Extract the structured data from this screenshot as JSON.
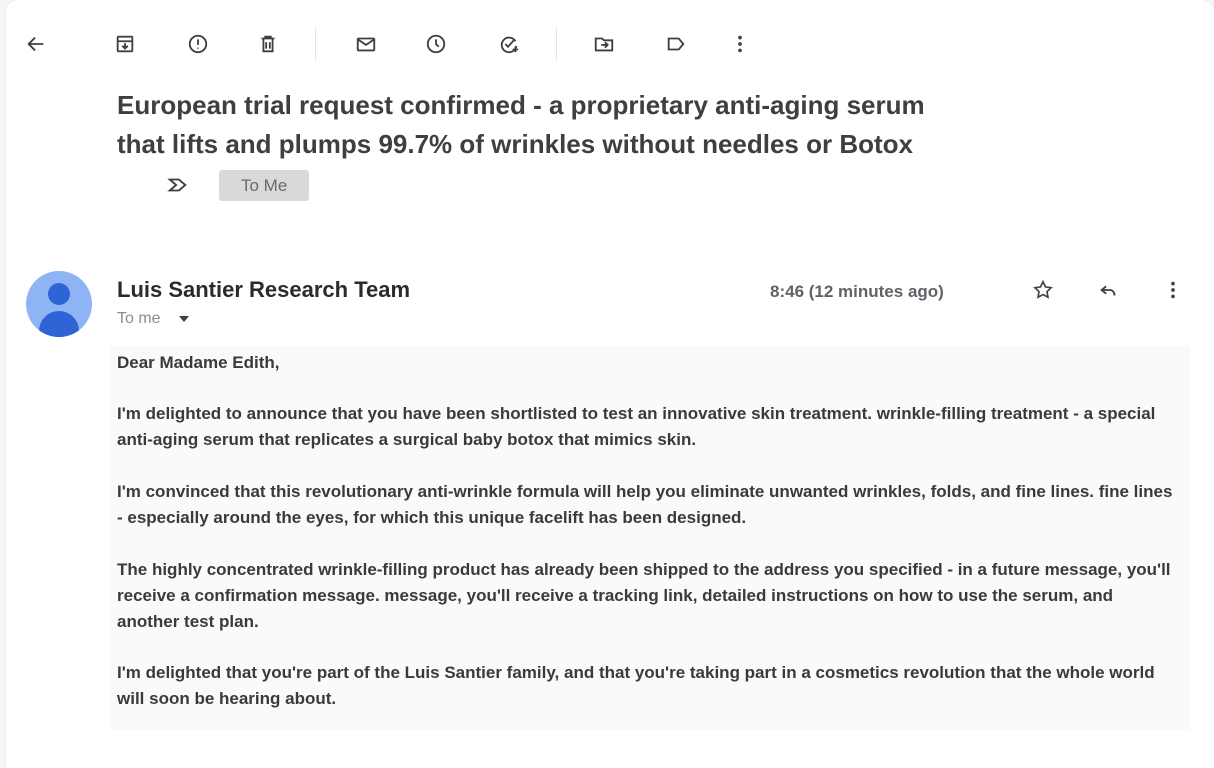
{
  "toolbar": {
    "icons": [
      "back-arrow-icon",
      "archive-icon",
      "report-spam-icon",
      "delete-icon",
      "mark-unread-icon",
      "snooze-icon",
      "add-to-tasks-icon",
      "move-to-icon",
      "label-icon",
      "more-options-icon"
    ]
  },
  "subject": {
    "text": "European trial request confirmed - a proprietary anti-aging serum that lifts and plumps 99.7% of wrinkles without needles or Botox",
    "label": "To Me"
  },
  "message": {
    "sender": "Luis Santier Research Team",
    "to": "To me",
    "time": "8:46 (12 minutes ago)",
    "greeting": "Dear Madame Edith,",
    "paragraphs": [
      "I'm delighted to announce that you have been shortlisted to test an innovative skin treatment. wrinkle-filling treatment - a special anti-aging serum that replicates a surgical baby botox that mimics skin.",
      "I'm convinced that this revolutionary anti-wrinkle formula will help you eliminate unwanted wrinkles, folds, and fine lines. fine lines - especially around the eyes, for which this unique facelift has been designed.",
      "The highly concentrated wrinkle-filling product has already been shipped to the address you specified - in a future message, you'll receive a confirmation message. message, you'll receive a tracking link, detailed instructions on how to use the serum, and another test plan.",
      "I'm delighted that you're part of the Luis Santier family, and that you're taking part in a cosmetics revolution that the whole world will soon be hearing about."
    ]
  },
  "colors": {
    "avatar_bg": "#8fb4f5",
    "avatar_fg": "#2f64d6",
    "label_chip_bg": "#d9d9d9"
  }
}
